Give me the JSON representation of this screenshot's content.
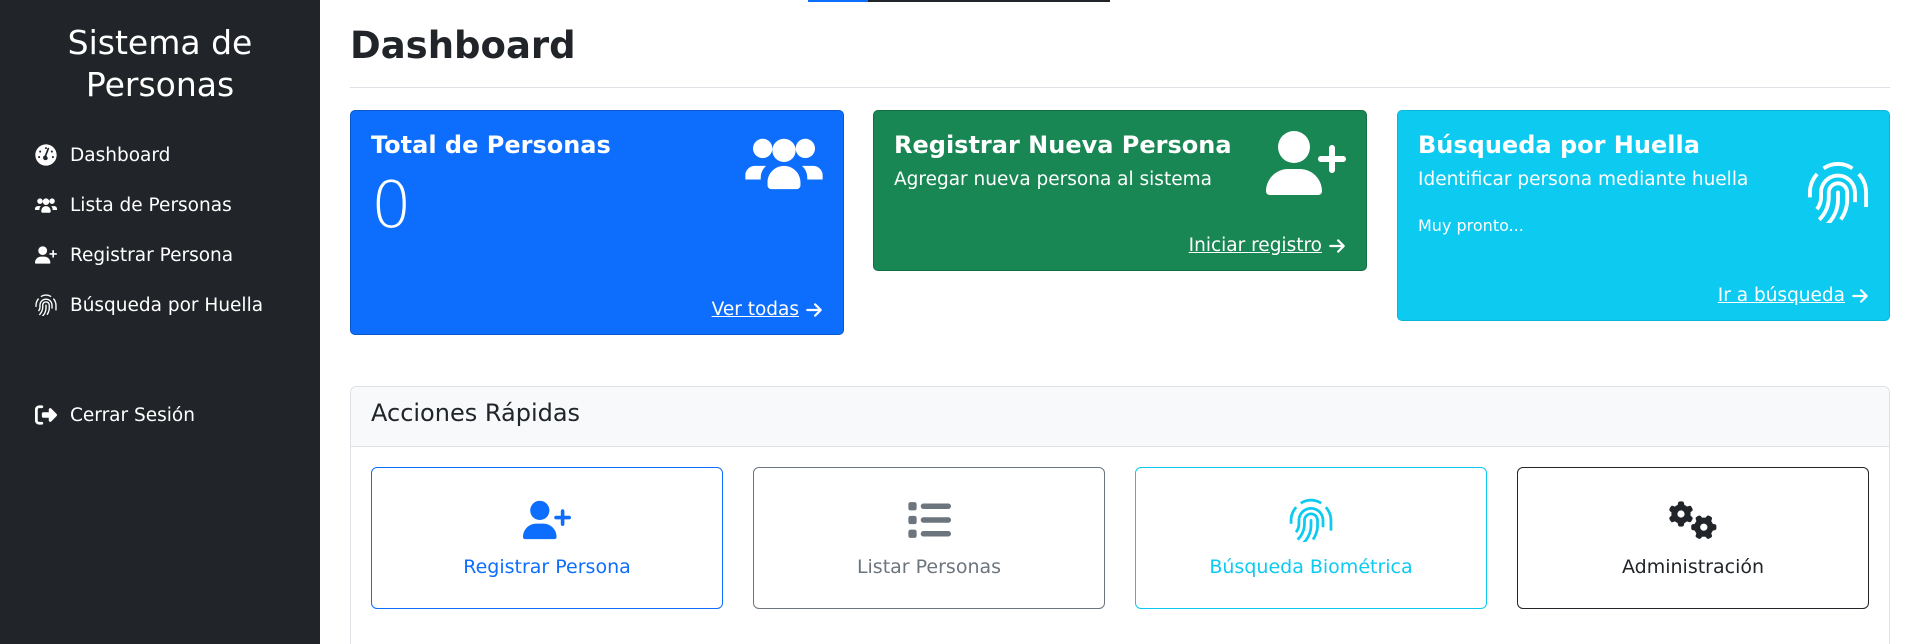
{
  "sidebar": {
    "brand_line1": "Sistema de",
    "brand_line2": "Personas",
    "items": [
      {
        "label": "Dashboard",
        "icon": "dashboard-icon"
      },
      {
        "label": "Lista de Personas",
        "icon": "users-icon"
      },
      {
        "label": "Registrar Persona",
        "icon": "user-plus-icon"
      },
      {
        "label": "Búsqueda por Huella",
        "icon": "fingerprint-icon"
      }
    ],
    "logout": {
      "label": "Cerrar Sesión",
      "icon": "sign-out-icon"
    }
  },
  "main": {
    "title": "Dashboard",
    "cards": {
      "total": {
        "title": "Total de Personas",
        "value": "0",
        "link": "Ver todas",
        "icon": "users-icon",
        "color": "#0d6efd"
      },
      "register": {
        "title": "Registrar Nueva Persona",
        "subtitle": "Agregar nueva persona al sistema",
        "link": "Iniciar registro",
        "icon": "user-plus-icon",
        "color": "#198754"
      },
      "search": {
        "title": "Búsqueda por Huella",
        "subtitle": "Identificar persona mediante huella",
        "note": "Muy pronto...",
        "link": "Ir a búsqueda",
        "icon": "fingerprint-icon",
        "color": "#0dcaf0"
      }
    },
    "quick_actions": {
      "title": "Acciones Rápidas",
      "items": [
        {
          "label": "Registrar Persona",
          "icon": "user-plus-icon",
          "color": "#0d6efd"
        },
        {
          "label": "Listar Personas",
          "icon": "list-icon",
          "color": "#6c757d"
        },
        {
          "label": "Búsqueda Biométrica",
          "icon": "fingerprint-icon",
          "color": "#0dcaf0"
        },
        {
          "label": "Administración",
          "icon": "cogs-icon",
          "color": "#212529"
        }
      ]
    }
  }
}
